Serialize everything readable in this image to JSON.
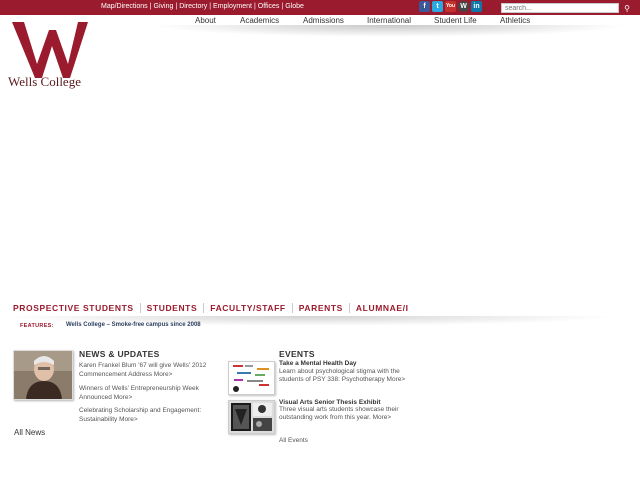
{
  "utility_links": [
    "Map/Directions",
    "Giving",
    "Directory",
    "Employment",
    "Offices",
    "Globe"
  ],
  "social_icons": [
    {
      "name": "facebook-icon",
      "glyph": "f"
    },
    {
      "name": "twitter-icon",
      "glyph": "t"
    },
    {
      "name": "youtube-icon",
      "glyph": "You"
    },
    {
      "name": "wordpress-icon",
      "glyph": "W"
    },
    {
      "name": "linkedin-icon",
      "glyph": "in"
    }
  ],
  "search": {
    "placeholder": "search..."
  },
  "logo": {
    "text": "Wells College"
  },
  "main_nav": [
    "About",
    "Academics",
    "Admissions",
    "International",
    "Student Life",
    "Athletics"
  ],
  "audience_nav": [
    "PROSPECTIVE STUDENTS",
    "STUDENTS",
    "FACULTY/STAFF",
    "PARENTS",
    "ALUMNAE/I"
  ],
  "features": {
    "label": "FEATURES:",
    "text": "Wells College – Smoke-free campus since 2008"
  },
  "news": {
    "title": "NEWS & UPDATES",
    "items": [
      "Karen Frankel Blum '67 will give Wells' 2012 Commencement Address More>",
      "Winners of Wells' Entrepreneurship Week Announced More>",
      "Celebrating Scholarship and Engagement: Sustainability More>"
    ],
    "all_label": "All News"
  },
  "events": {
    "title": "EVENTS",
    "items": [
      {
        "title": "Take a Mental Health Day",
        "desc": "Learn about psychological stigma with the students of PSY 338: Psychotherapy More>"
      },
      {
        "title": "Visual Arts Senior Thesis Exhibit",
        "desc": "Three visual arts students showcase their outstanding work from this year. More>"
      }
    ],
    "all_label": "All Events"
  },
  "colors": {
    "brand": "#9a1b2d",
    "nav_text": "#333333",
    "feature_text": "#2c3f5f"
  }
}
